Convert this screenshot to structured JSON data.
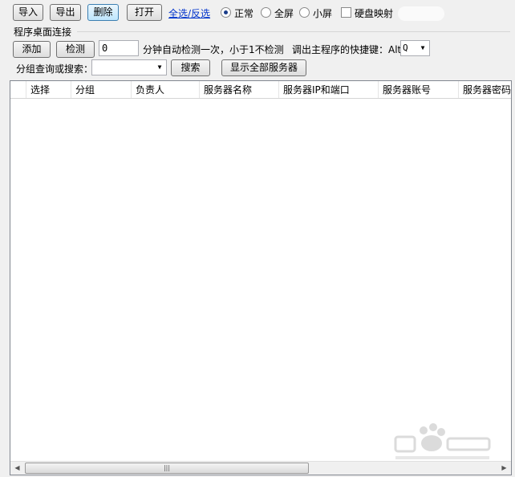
{
  "toolbar": {
    "import_label": "导入",
    "export_label": "导出",
    "delete_label": "删除",
    "open_label": "打开",
    "select_toggle_label": "全选/反选",
    "view_modes": [
      {
        "label": "正常",
        "checked": true
      },
      {
        "label": "全屏",
        "checked": false
      },
      {
        "label": "小屏",
        "checked": false
      }
    ],
    "disk_map_label": "硬盘映射",
    "disk_map_checked": false
  },
  "desktop_section": {
    "title": "程序桌面连接",
    "add_label": "添加",
    "check_label": "检测",
    "interval_value": "0",
    "interval_text": "分钟自动检测一次，小于1不检测",
    "hotkey_text": "调出主程序的快捷键：Alt+",
    "hotkey_value": "Q"
  },
  "search": {
    "label": "分组查询或搜索：",
    "value": "",
    "search_label": "搜索",
    "show_all_label": "显示全部服务器"
  },
  "table": {
    "columns": [
      "选择",
      "分组",
      "负责人",
      "服务器名称",
      "服务器IP和端口",
      "服务器账号",
      "服务器密码"
    ],
    "rows": []
  },
  "scrollbar": {
    "thumb_grip": "|||"
  },
  "colors": {
    "link": "#0033cc",
    "active_button": "#bee6fd"
  }
}
